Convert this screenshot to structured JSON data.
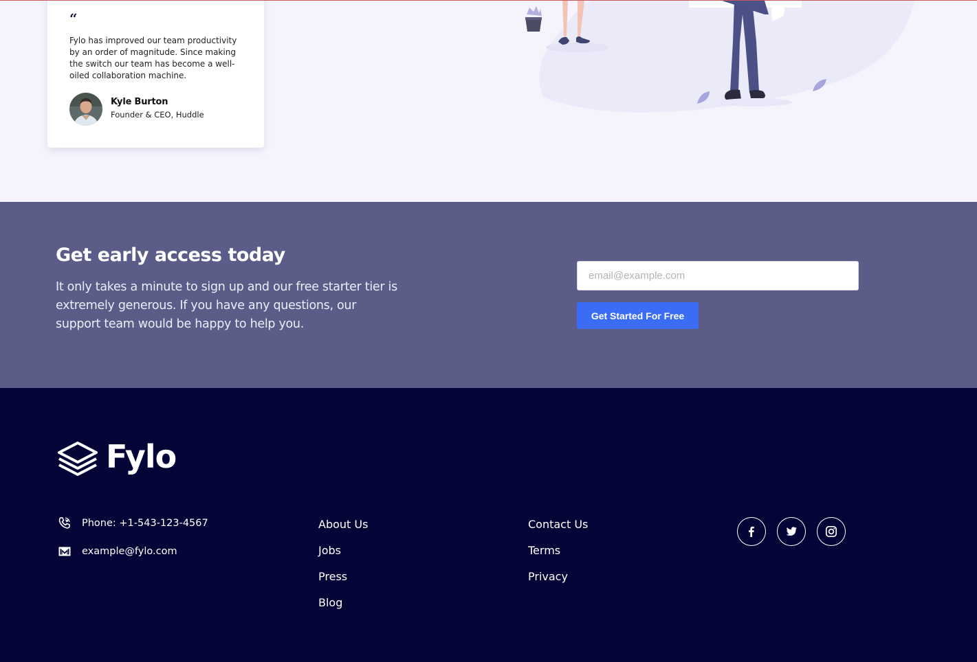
{
  "testimonial": {
    "quote_mark": "“",
    "quote": "Fylo has improved our team productivity by an order of magnitude. Since making the switch our team has become a well-oiled collaboration machine.",
    "author_name": "Kyle Burton",
    "author_role": "Founder & CEO, Huddle"
  },
  "cta": {
    "title": "Get early access today",
    "text": "It only takes a minute to sign up and our free starter tier is extremely generous. If you have any questions, our support team would be happy to help you.",
    "email_placeholder": "email@example.com",
    "email_value": "",
    "button_label": "Get Started For Free"
  },
  "footer": {
    "logo_text": "Fylo",
    "phone": "Phone: +1-543-123-4567",
    "email": "example@fylo.com",
    "links_col1": [
      "About Us",
      "Jobs",
      "Press",
      "Blog"
    ],
    "links_col2": [
      "Contact Us",
      "Terms",
      "Privacy"
    ],
    "socials": [
      {
        "icon": "facebook-icon"
      },
      {
        "icon": "twitter-icon"
      },
      {
        "icon": "instagram-icon"
      }
    ]
  },
  "colors": {
    "page_bg": "#f5f4fd",
    "cta_bg": "#5b5c88",
    "footer_bg": "#050436",
    "button_bg": "#3a6cf6",
    "illustration_accent": "#4b5086"
  }
}
